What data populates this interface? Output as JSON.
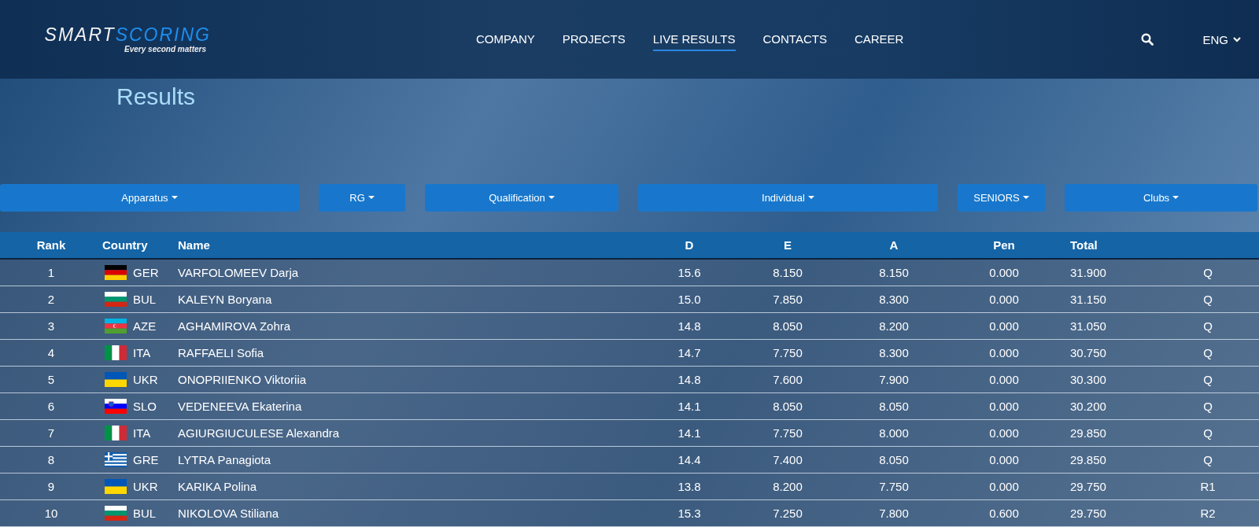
{
  "logo": {
    "brand_part_1": "SMART",
    "brand_part_2": "SCORING",
    "tagline": "Every second matters"
  },
  "nav": [
    {
      "label": "COMPANY",
      "selected": false
    },
    {
      "label": "PROJECTS",
      "selected": false
    },
    {
      "label": "LIVE RESULTS",
      "selected": true
    },
    {
      "label": "CONTACTS",
      "selected": false
    },
    {
      "label": "CAREER",
      "selected": false
    }
  ],
  "language": "ENG",
  "page_title": "Results",
  "filters": [
    "Apparatus",
    "RG",
    "Qualification",
    "Individual",
    "SENIORS",
    "Clubs"
  ],
  "table": {
    "columns": [
      "Rank",
      "Country",
      "Name",
      "D",
      "E",
      "A",
      "Pen",
      "Total"
    ],
    "rows": [
      {
        "rank": "1",
        "kind": "de",
        "country": "GER",
        "name": "VARFOLOMEEV Darja",
        "d": "15.6",
        "e": "8.150",
        "a": "8.150",
        "pen": "0.000",
        "total": "31.900",
        "status": "Q"
      },
      {
        "rank": "2",
        "kind": "bg",
        "country": "BUL",
        "name": "KALEYN Boryana",
        "d": "15.0",
        "e": "7.850",
        "a": "8.300",
        "pen": "0.000",
        "total": "31.150",
        "status": "Q"
      },
      {
        "rank": "3",
        "kind": "az",
        "country": "AZE",
        "name": "AGHAMIROVA Zohra",
        "d": "14.8",
        "e": "8.050",
        "a": "8.200",
        "pen": "0.000",
        "total": "31.050",
        "status": "Q"
      },
      {
        "rank": "4",
        "kind": "it",
        "country": "ITA",
        "name": "RAFFAELI Sofia",
        "d": "14.7",
        "e": "7.750",
        "a": "8.300",
        "pen": "0.000",
        "total": "30.750",
        "status": "Q"
      },
      {
        "rank": "5",
        "kind": "ua",
        "country": "UKR",
        "name": "ONOPRIIENKO Viktoriia",
        "d": "14.8",
        "e": "7.600",
        "a": "7.900",
        "pen": "0.000",
        "total": "30.300",
        "status": "Q"
      },
      {
        "rank": "6",
        "kind": "si",
        "country": "SLO",
        "name": "VEDENEEVA Ekaterina",
        "d": "14.1",
        "e": "8.050",
        "a": "8.050",
        "pen": "0.000",
        "total": "30.200",
        "status": "Q"
      },
      {
        "rank": "7",
        "kind": "it",
        "country": "ITA",
        "name": "AGIURGIUCULESE Alexandra",
        "d": "14.1",
        "e": "7.750",
        "a": "8.000",
        "pen": "0.000",
        "total": "29.850",
        "status": "Q"
      },
      {
        "rank": "8",
        "kind": "gr",
        "country": "GRE",
        "name": "LYTRA Panagiota",
        "d": "14.4",
        "e": "7.400",
        "a": "8.050",
        "pen": "0.000",
        "total": "29.850",
        "status": "Q"
      },
      {
        "rank": "9",
        "kind": "ua",
        "country": "UKR",
        "name": "KARIKA Polina",
        "d": "13.8",
        "e": "8.200",
        "a": "7.750",
        "pen": "0.000",
        "total": "29.750",
        "status": "R1"
      },
      {
        "rank": "10",
        "kind": "bg",
        "country": "BUL",
        "name": "NIKOLOVA Stiliana",
        "d": "15.3",
        "e": "7.250",
        "a": "7.800",
        "pen": "0.600",
        "total": "29.750",
        "status": "R2"
      }
    ]
  }
}
